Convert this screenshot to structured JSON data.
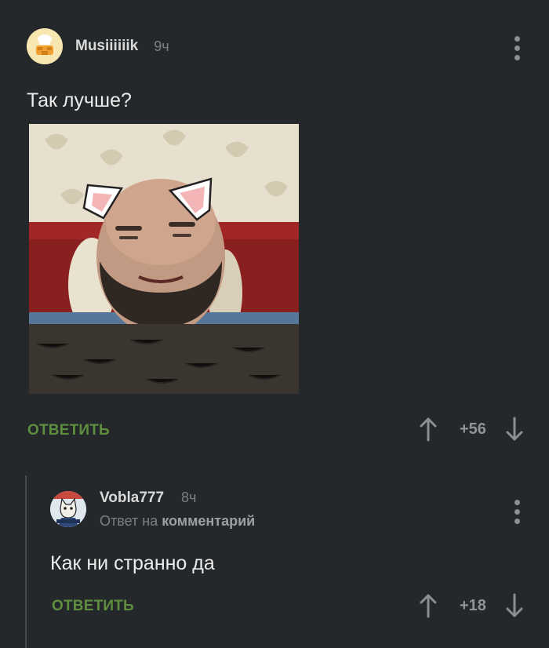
{
  "post_comment": {
    "username": "Musiiiiiik",
    "time": "9ч",
    "text": "Так лучше?",
    "reply_label": "ОТВЕТИТЬ",
    "score": "+56",
    "icons": {
      "avatar": "chef-avatar-icon",
      "menu": "more-vertical-icon",
      "upvote": "arrow-up-icon",
      "downvote": "arrow-down-icon"
    }
  },
  "reply_comment": {
    "username": "Vobla777",
    "time": "8ч",
    "reply_to_prefix": "Ответ на",
    "reply_to_target": "комментарий",
    "text": "Как ни странно да",
    "reply_label": "ОТВЕТИТЬ",
    "score": "+18",
    "avatar_caption": "YES WE CAT"
  },
  "colors": {
    "background": "#24282b",
    "reply_green": "#5f8f3e",
    "muted": "#7b8085",
    "thread_line": "#464b50"
  }
}
